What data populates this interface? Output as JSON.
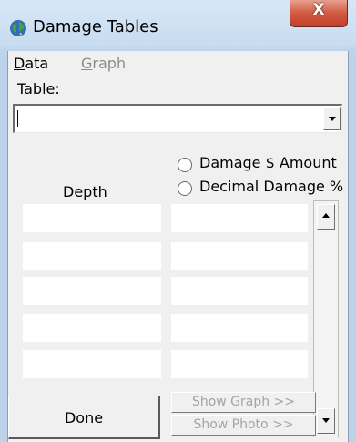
{
  "window": {
    "title": "Damage Tables",
    "close_glyph": "X",
    "app_icon": "globe-icon"
  },
  "menu": {
    "items": [
      {
        "label": "Data",
        "enabled": true
      },
      {
        "label": "Graph",
        "enabled": false
      }
    ]
  },
  "table_selector": {
    "label": "Table:",
    "value": ""
  },
  "value_mode": {
    "options": [
      {
        "label": "Damage $ Amount",
        "selected": false
      },
      {
        "label": "Decimal Damage %",
        "selected": false
      }
    ]
  },
  "grid": {
    "depth_header": "Depth",
    "rows": [
      {
        "depth": "",
        "damage": ""
      },
      {
        "depth": "",
        "damage": ""
      },
      {
        "depth": "",
        "damage": ""
      },
      {
        "depth": "",
        "damage": ""
      },
      {
        "depth": "",
        "damage": ""
      }
    ]
  },
  "buttons": {
    "done": "Done",
    "show_graph": "Show Graph >>",
    "show_photo": "Show Photo >>"
  },
  "colors": {
    "titlebar": "#c8dcf0",
    "close_button": "#d25a43",
    "client_background": "#f0f0f0",
    "disabled_text": "#a4a4a4"
  }
}
